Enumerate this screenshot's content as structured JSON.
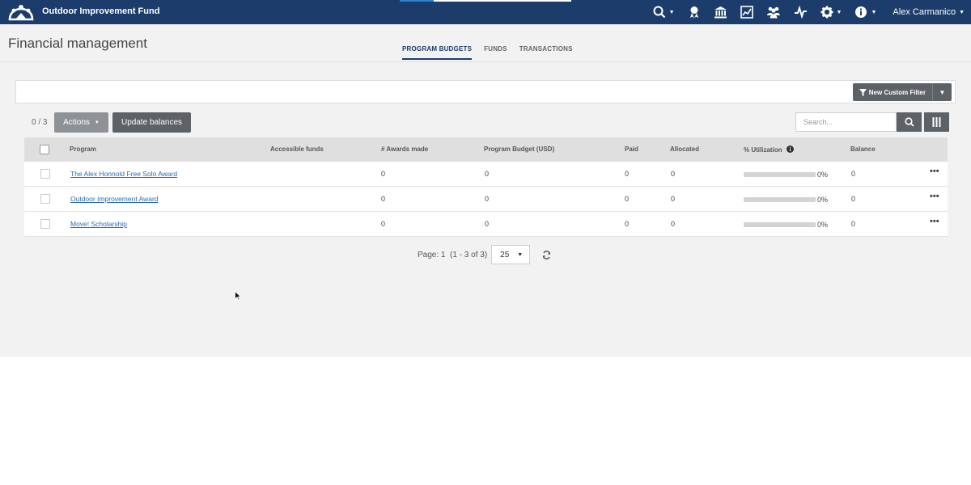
{
  "topbar": {
    "org_name": "Outdoor Improvement Fund",
    "user_name": "Alex Carmanico",
    "loading_progress": 0.2,
    "icons": [
      "search-icon",
      "awards-icon",
      "bank-icon",
      "chart-icon",
      "people-icon",
      "activity-icon",
      "gear-icon",
      "info-icon"
    ],
    "colors": {
      "bar": "#1c3d6b",
      "accent": "#2f7fd3"
    }
  },
  "header": {
    "title": "Financial management",
    "tabs": [
      {
        "label": "PROGRAM BUDGETS",
        "active": true
      },
      {
        "label": "FUNDS",
        "active": false
      },
      {
        "label": "TRANSACTIONS",
        "active": false
      }
    ]
  },
  "filter": {
    "button_label": "New Custom Filter"
  },
  "toolbar": {
    "selection_count": "0 / 3",
    "actions_label": "Actions",
    "update_label": "Update balances",
    "search_placeholder": "Search..."
  },
  "table": {
    "columns": [
      "Program",
      "Accessible funds",
      "# Awards made",
      "Program Budget (USD)",
      "Paid",
      "Allocated",
      "% Utilization",
      "Balance"
    ],
    "rows": [
      {
        "program": "The Alex Honnold Free Solo Award",
        "accessible_funds": "",
        "awards": "0",
        "budget": "0",
        "paid": "0",
        "allocated": "0",
        "utilization": 0,
        "utilization_label": "0%",
        "balance": "0"
      },
      {
        "program": "Outdoor Improvement Award",
        "accessible_funds": "",
        "awards": "0",
        "budget": "0",
        "paid": "0",
        "allocated": "0",
        "utilization": 0,
        "utilization_label": "0%",
        "balance": "0"
      },
      {
        "program": "Move! Scholarship",
        "accessible_funds": "",
        "awards": "0",
        "budget": "0",
        "paid": "0",
        "allocated": "0",
        "utilization": 0,
        "utilization_label": "0%",
        "balance": "0"
      }
    ]
  },
  "pager": {
    "text": "Page: 1  (1 - 3 of 3)",
    "page_size": "25"
  }
}
